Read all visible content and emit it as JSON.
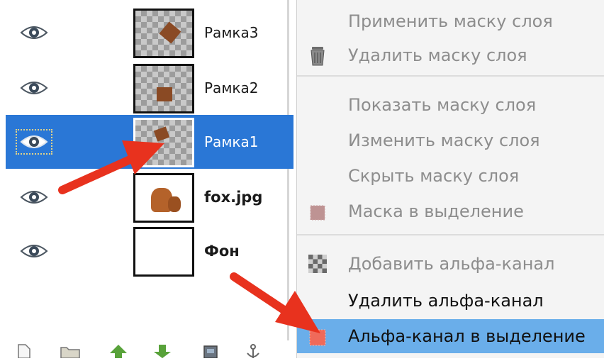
{
  "layers": [
    {
      "name": "Рамка3",
      "selected": false,
      "bold": false,
      "thumb": "frame3"
    },
    {
      "name": "Рамка2",
      "selected": false,
      "bold": false,
      "thumb": "frame2"
    },
    {
      "name": "Рамка1",
      "selected": true,
      "bold": false,
      "thumb": "frame1"
    },
    {
      "name": "fox.jpg",
      "selected": false,
      "bold": true,
      "thumb": "photo"
    },
    {
      "name": "Фон",
      "selected": false,
      "bold": true,
      "thumb": "white"
    }
  ],
  "menu": {
    "items": [
      {
        "label": "Применить маску слоя",
        "enabled": false,
        "icon": "none"
      },
      {
        "label": "Удалить маску слоя",
        "enabled": false,
        "icon": "trash-icon"
      },
      {
        "label": "Показать маску слоя",
        "enabled": false,
        "icon": "none"
      },
      {
        "label": "Изменить маску слоя",
        "enabled": false,
        "icon": "none"
      },
      {
        "label": "Скрыть маску слоя",
        "enabled": false,
        "icon": "none"
      },
      {
        "label": "Маска в выделение",
        "enabled": false,
        "icon": "mask-selection-icon"
      },
      {
        "label": "Добавить альфа-канал",
        "enabled": false,
        "icon": "checker-icon"
      },
      {
        "label": "Удалить альфа-канал",
        "enabled": true,
        "icon": "none"
      },
      {
        "label": "Альфа-канал в выделение",
        "enabled": true,
        "highlighted": true,
        "icon": "alpha-selection-icon"
      }
    ]
  },
  "toolbar": {
    "icons": [
      "new-layer-icon",
      "folder-icon",
      "raise-layer-icon",
      "lower-layer-icon",
      "duplicate-layer-icon",
      "anchor-icon"
    ]
  },
  "colors": {
    "selection": "#2a77d6",
    "menu_highlight": "#6aaeea",
    "arrow": "#e8321e"
  }
}
